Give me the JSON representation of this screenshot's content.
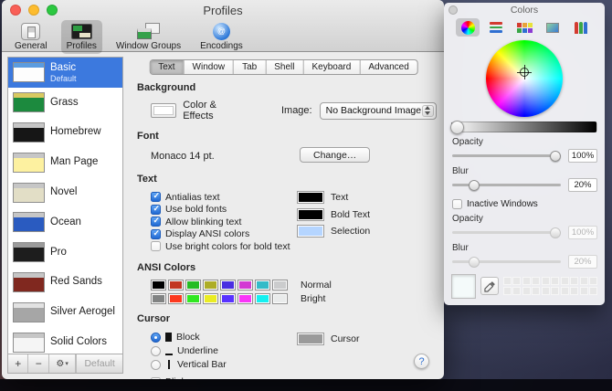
{
  "window": {
    "title": "Profiles",
    "toolbar_items": [
      "General",
      "Profiles",
      "Window Groups",
      "Encodings"
    ],
    "help_label": "?"
  },
  "sidebar": {
    "profiles": [
      {
        "name": "Basic",
        "subtitle": "Default",
        "thumb": {
          "bar": "#5b9ce0",
          "body": "#fdfdfd"
        }
      },
      {
        "name": "Grass",
        "thumb": {
          "bar": "#d9c961",
          "body": "#1c8a3e"
        }
      },
      {
        "name": "Homebrew",
        "thumb": {
          "bar": "#c6c6c6",
          "body": "#161616"
        }
      },
      {
        "name": "Man Page",
        "thumb": {
          "bar": "#c6c6c6",
          "body": "#fdf1a0"
        }
      },
      {
        "name": "Novel",
        "thumb": {
          "bar": "#c6c6c6",
          "body": "#e2dec6"
        }
      },
      {
        "name": "Ocean",
        "thumb": {
          "bar": "#c6c6c6",
          "body": "#2a5bc0"
        }
      },
      {
        "name": "Pro",
        "thumb": {
          "bar": "#9b9b9b",
          "body": "#1d1d1d"
        }
      },
      {
        "name": "Red Sands",
        "thumb": {
          "bar": "#c6c6c6",
          "body": "#80281f"
        }
      },
      {
        "name": "Silver Aerogel",
        "thumb": {
          "bar": "#e2e2e2",
          "body": "#a6a6a6"
        }
      },
      {
        "name": "Solid Colors",
        "thumb": {
          "bar": "#c6c6c6",
          "body": "#f5f5f5"
        }
      }
    ],
    "add_label": "+",
    "remove_label": "−",
    "gear_label": "⚙",
    "gear_arrow": "▾",
    "default_label": "Default"
  },
  "tabs": [
    "Text",
    "Window",
    "Tab",
    "Shell",
    "Keyboard",
    "Advanced"
  ],
  "sections": {
    "background": {
      "heading": "Background",
      "color_effects_label": "Color & Effects",
      "image_label": "Image:",
      "image_value": "No Background Image"
    },
    "font": {
      "heading": "Font",
      "value": "Monaco 14 pt.",
      "change_label": "Change…"
    },
    "text": {
      "heading": "Text",
      "options": [
        {
          "label": "Antialias text",
          "checked": true
        },
        {
          "label": "Use bold fonts",
          "checked": true
        },
        {
          "label": "Allow blinking text",
          "checked": true
        },
        {
          "label": "Display ANSI colors",
          "checked": true
        },
        {
          "label": "Use bright colors for bold text",
          "checked": false
        }
      ],
      "swatches": [
        {
          "label": "Text",
          "color": "#000000"
        },
        {
          "label": "Bold Text",
          "color": "#000000"
        },
        {
          "label": "Selection",
          "color": "#b5d5ff"
        }
      ]
    },
    "ansi": {
      "heading": "ANSI Colors",
      "rows": [
        {
          "label": "Normal",
          "colors": [
            "#000000",
            "#c23621",
            "#25bc24",
            "#adad27",
            "#492ee1",
            "#d338d3",
            "#33bbc8",
            "#cbcccd"
          ]
        },
        {
          "label": "Bright",
          "colors": [
            "#818383",
            "#fc391f",
            "#31e722",
            "#eaec23",
            "#5833ff",
            "#f935f8",
            "#14f0f0",
            "#e9ebeb"
          ]
        }
      ]
    },
    "cursor": {
      "heading": "Cursor",
      "options": [
        {
          "label": "Block",
          "selected": true
        },
        {
          "label": "Underline",
          "selected": false
        },
        {
          "label": "Vertical Bar",
          "selected": false
        }
      ],
      "blink_label": "Blink cursor",
      "swatch": {
        "label": "Cursor",
        "color": "#9a9a9a"
      }
    }
  },
  "colors_panel": {
    "title": "Colors",
    "opacity_label": "Opacity",
    "opacity_value": "100%",
    "blur_label": "Blur",
    "blur_value": "20%",
    "inactive": {
      "label": "Inactive Windows",
      "checked": false,
      "opacity_label": "Opacity",
      "opacity_value": "100%",
      "blur_label": "Blur",
      "blur_value": "20%"
    },
    "current_color": "#f4fafa",
    "accent_color": "#3c79de"
  }
}
